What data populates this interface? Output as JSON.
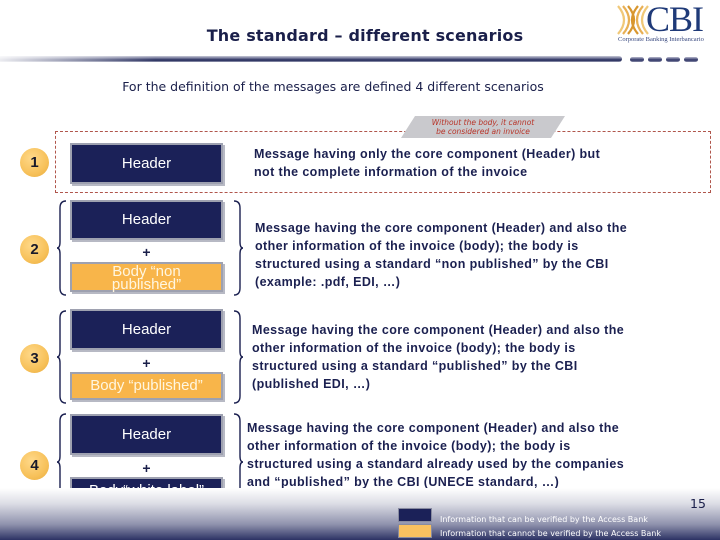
{
  "header": {
    "title": "The standard – different scenarios",
    "subtitle": "For the definition of the messages are defined 4 different scenarios",
    "logo": {
      "text": "CBI",
      "subtext": "Corporate Banking Interbancario",
      "icon": "cbi-logo-icon"
    }
  },
  "note": {
    "line1": "Without the body, it cannot",
    "line2": "be considered an invoice"
  },
  "scenarios": [
    {
      "number": "1",
      "header_label": "Header",
      "plus": "",
      "body_label": "",
      "description_lines": [
        "Message  having only the core component (Header) but",
        "not the complete information of the invoice"
      ]
    },
    {
      "number": "2",
      "header_label": "Header",
      "plus": "+",
      "body_label": "Body “non published”",
      "body_line1": "Body “non",
      "body_line2": "published”",
      "body_color": "orange",
      "description_lines": [
        "Message  having the core component (Header) and also the",
        "other information of the invoice (body); the body is",
        "structured using a standard “non published” by the CBI",
        "(example: .pdf, EDI, …)"
      ]
    },
    {
      "number": "3",
      "header_label": "Header",
      "plus": "+",
      "body_label": "Body “published”",
      "body_color": "orange",
      "description_lines": [
        "Message  having the core component (Header) and also the",
        "other information of the invoice (body); the body is",
        "structured using a standard “published” by the CBI",
        "(published EDI, …)"
      ]
    },
    {
      "number": "4",
      "header_label": "Header",
      "plus": "+",
      "body_label": "Body“white label”",
      "body_color": "navy",
      "description_lines": [
        "Message  having the core component (Header) and also the",
        "other information of the invoice (body); the body is",
        "structured using a standard already used by the companies",
        "and “published” by the CBI (UNECE standard, …)"
      ]
    }
  ],
  "footer": {
    "page_number": "15",
    "legend": [
      {
        "label": "Information that can be verified by the Access Bank",
        "color": "#1b2158"
      },
      {
        "label": "Information that cannot be verified by the Access Bank",
        "color": "#f8c060"
      }
    ]
  },
  "colors": {
    "navy": "#1b2158",
    "orange": "#f8b54a",
    "circle": "#f7c15a",
    "note_text": "#b8352a",
    "dashed_border": "#b0564c"
  }
}
